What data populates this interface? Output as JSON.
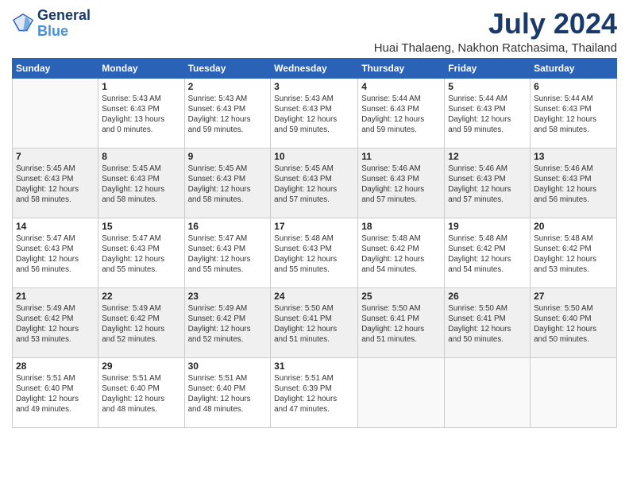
{
  "logo": {
    "line1": "General",
    "line2": "Blue"
  },
  "title": "July 2024",
  "subtitle": "Huai Thalaeng, Nakhon Ratchasima, Thailand",
  "columns": [
    "Sunday",
    "Monday",
    "Tuesday",
    "Wednesday",
    "Thursday",
    "Friday",
    "Saturday"
  ],
  "weeks": [
    [
      {
        "day": "",
        "info": ""
      },
      {
        "day": "1",
        "info": "Sunrise: 5:43 AM\nSunset: 6:43 PM\nDaylight: 13 hours\nand 0 minutes."
      },
      {
        "day": "2",
        "info": "Sunrise: 5:43 AM\nSunset: 6:43 PM\nDaylight: 12 hours\nand 59 minutes."
      },
      {
        "day": "3",
        "info": "Sunrise: 5:43 AM\nSunset: 6:43 PM\nDaylight: 12 hours\nand 59 minutes."
      },
      {
        "day": "4",
        "info": "Sunrise: 5:44 AM\nSunset: 6:43 PM\nDaylight: 12 hours\nand 59 minutes."
      },
      {
        "day": "5",
        "info": "Sunrise: 5:44 AM\nSunset: 6:43 PM\nDaylight: 12 hours\nand 59 minutes."
      },
      {
        "day": "6",
        "info": "Sunrise: 5:44 AM\nSunset: 6:43 PM\nDaylight: 12 hours\nand 58 minutes."
      }
    ],
    [
      {
        "day": "7",
        "info": "Sunrise: 5:45 AM\nSunset: 6:43 PM\nDaylight: 12 hours\nand 58 minutes."
      },
      {
        "day": "8",
        "info": "Sunrise: 5:45 AM\nSunset: 6:43 PM\nDaylight: 12 hours\nand 58 minutes."
      },
      {
        "day": "9",
        "info": "Sunrise: 5:45 AM\nSunset: 6:43 PM\nDaylight: 12 hours\nand 58 minutes."
      },
      {
        "day": "10",
        "info": "Sunrise: 5:45 AM\nSunset: 6:43 PM\nDaylight: 12 hours\nand 57 minutes."
      },
      {
        "day": "11",
        "info": "Sunrise: 5:46 AM\nSunset: 6:43 PM\nDaylight: 12 hours\nand 57 minutes."
      },
      {
        "day": "12",
        "info": "Sunrise: 5:46 AM\nSunset: 6:43 PM\nDaylight: 12 hours\nand 57 minutes."
      },
      {
        "day": "13",
        "info": "Sunrise: 5:46 AM\nSunset: 6:43 PM\nDaylight: 12 hours\nand 56 minutes."
      }
    ],
    [
      {
        "day": "14",
        "info": "Sunrise: 5:47 AM\nSunset: 6:43 PM\nDaylight: 12 hours\nand 56 minutes."
      },
      {
        "day": "15",
        "info": "Sunrise: 5:47 AM\nSunset: 6:43 PM\nDaylight: 12 hours\nand 55 minutes."
      },
      {
        "day": "16",
        "info": "Sunrise: 5:47 AM\nSunset: 6:43 PM\nDaylight: 12 hours\nand 55 minutes."
      },
      {
        "day": "17",
        "info": "Sunrise: 5:48 AM\nSunset: 6:43 PM\nDaylight: 12 hours\nand 55 minutes."
      },
      {
        "day": "18",
        "info": "Sunrise: 5:48 AM\nSunset: 6:42 PM\nDaylight: 12 hours\nand 54 minutes."
      },
      {
        "day": "19",
        "info": "Sunrise: 5:48 AM\nSunset: 6:42 PM\nDaylight: 12 hours\nand 54 minutes."
      },
      {
        "day": "20",
        "info": "Sunrise: 5:48 AM\nSunset: 6:42 PM\nDaylight: 12 hours\nand 53 minutes."
      }
    ],
    [
      {
        "day": "21",
        "info": "Sunrise: 5:49 AM\nSunset: 6:42 PM\nDaylight: 12 hours\nand 53 minutes."
      },
      {
        "day": "22",
        "info": "Sunrise: 5:49 AM\nSunset: 6:42 PM\nDaylight: 12 hours\nand 52 minutes."
      },
      {
        "day": "23",
        "info": "Sunrise: 5:49 AM\nSunset: 6:42 PM\nDaylight: 12 hours\nand 52 minutes."
      },
      {
        "day": "24",
        "info": "Sunrise: 5:50 AM\nSunset: 6:41 PM\nDaylight: 12 hours\nand 51 minutes."
      },
      {
        "day": "25",
        "info": "Sunrise: 5:50 AM\nSunset: 6:41 PM\nDaylight: 12 hours\nand 51 minutes."
      },
      {
        "day": "26",
        "info": "Sunrise: 5:50 AM\nSunset: 6:41 PM\nDaylight: 12 hours\nand 50 minutes."
      },
      {
        "day": "27",
        "info": "Sunrise: 5:50 AM\nSunset: 6:40 PM\nDaylight: 12 hours\nand 50 minutes."
      }
    ],
    [
      {
        "day": "28",
        "info": "Sunrise: 5:51 AM\nSunset: 6:40 PM\nDaylight: 12 hours\nand 49 minutes."
      },
      {
        "day": "29",
        "info": "Sunrise: 5:51 AM\nSunset: 6:40 PM\nDaylight: 12 hours\nand 48 minutes."
      },
      {
        "day": "30",
        "info": "Sunrise: 5:51 AM\nSunset: 6:40 PM\nDaylight: 12 hours\nand 48 minutes."
      },
      {
        "day": "31",
        "info": "Sunrise: 5:51 AM\nSunset: 6:39 PM\nDaylight: 12 hours\nand 47 minutes."
      },
      {
        "day": "",
        "info": ""
      },
      {
        "day": "",
        "info": ""
      },
      {
        "day": "",
        "info": ""
      }
    ]
  ]
}
